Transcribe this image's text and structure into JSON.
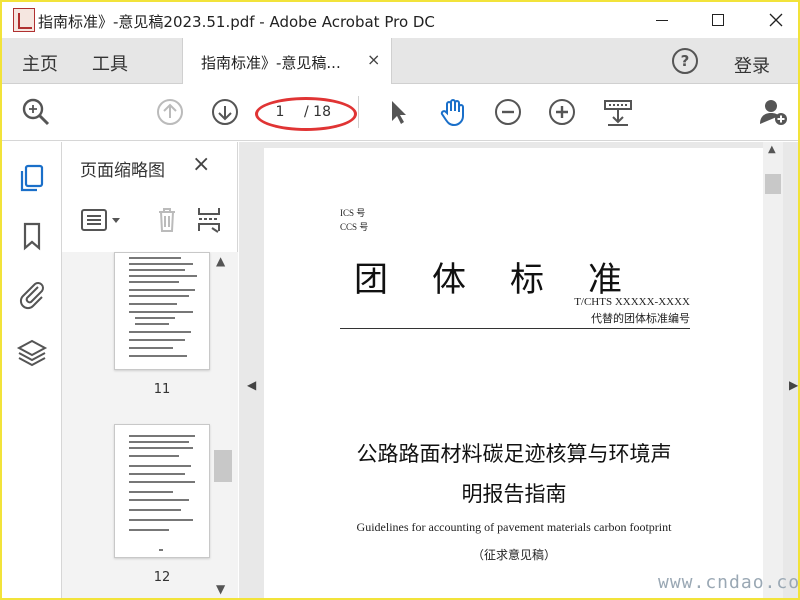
{
  "window": {
    "title": "指南标准》-意见稿2023.51.pdf - Adobe Acrobat Pro DC"
  },
  "tabbar": {
    "home": "主页",
    "tools": "工具",
    "doc_tab": "指南标准》-意见稿...",
    "close": "×",
    "help": "?",
    "login": "登录"
  },
  "toolbar": {
    "current_page": "1",
    "total_pages": "/ 18",
    "icons": [
      "search-zoom-icon",
      "prev-page-icon",
      "next-page-icon",
      "select-arrow-icon",
      "hand-tool-icon",
      "zoom-out-icon",
      "zoom-in-icon",
      "scroll-mode-icon",
      "add-user-icon"
    ]
  },
  "rail": {
    "icons": [
      "page-thumbnails-icon",
      "bookmark-icon",
      "attachment-icon",
      "layers-icon"
    ]
  },
  "thumbnail_panel": {
    "title": "页面缩略图",
    "close": "×",
    "thumbnails": [
      {
        "page": "11"
      },
      {
        "page": "12"
      }
    ]
  },
  "document": {
    "ics": "ICS 号",
    "ccs": "CCS 号",
    "std_title": "团体标准",
    "std_code": "T/CHTS XXXXX-XXXX",
    "std_sub": "代替的团体标准编号",
    "title_line1": "公路路面材料碳足迹核算与环境声",
    "title_line2": "明报告指南",
    "title_en": "Guidelines for accounting of pavement materials carbon footprint",
    "draft": "（征求意见稿）"
  },
  "watermark": "www.cndao.com",
  "colors": {
    "frame": "#f2e33a",
    "accent_blue": "#1a6fc9",
    "annotation_red": "#e03434"
  }
}
